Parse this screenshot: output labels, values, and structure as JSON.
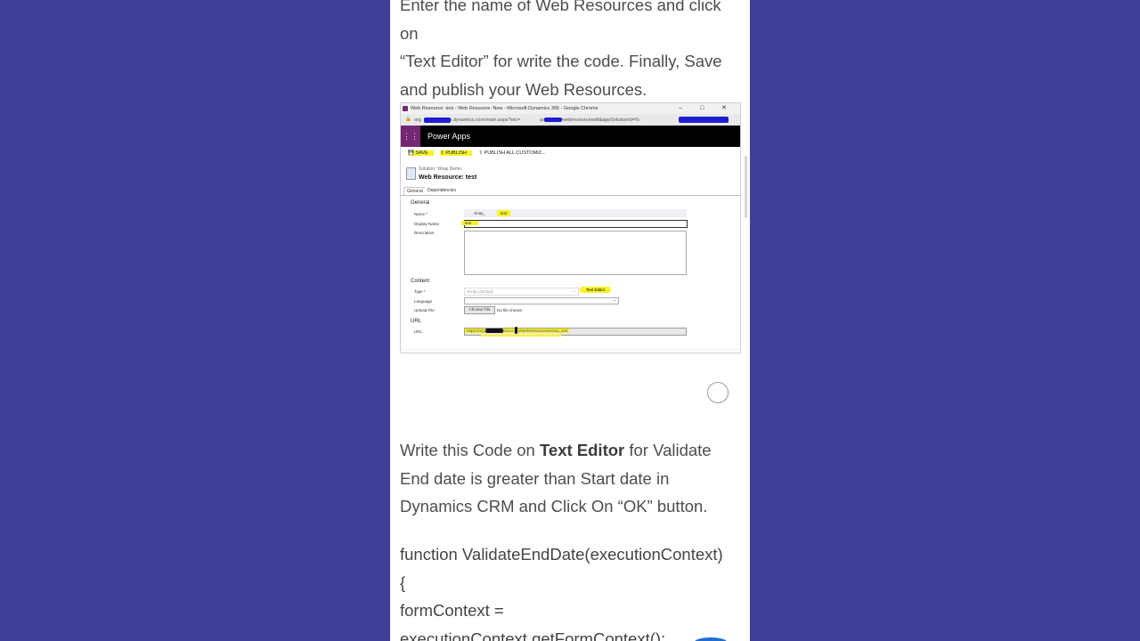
{
  "intro_text": {
    "line1": "Enter the name of Web Resources and click on",
    "line2": "“Text Editor” for write the code. Finally, Save",
    "line3": "and publish your Web Resources."
  },
  "screenshot": {
    "window_title": "Web Resource: test - Web Resource: New - Microsoft Dynamics 365 - Google Chrome",
    "window_controls": "–  □  ✕",
    "address_prefix": "org",
    "address_mid": "rm.dynamics.com/main.aspx?etc=",
    "address_tail": "pagetype=webresourceedit&appSolutionId=%",
    "app_name": "Power Apps",
    "commands": {
      "save": "SAVE",
      "publish": "PUBLISH",
      "publish_all": "PUBLISH ALL CUSTOMIZ..."
    },
    "solution_label": "Solution: Vinay Demo",
    "record_title": "Web Resource: test",
    "tabs": [
      "General",
      "Dependencies"
    ],
    "general_section": "General",
    "labels": {
      "name": "Name *",
      "display_name": "Display Name",
      "description": "Description",
      "type": "Type *",
      "language": "Language",
      "upload_file": "Upload File",
      "url": "URL"
    },
    "name_prefix": "vinay_",
    "name_value": "test",
    "display_name_value": "test",
    "content_section": "Content",
    "type_value": "Script (JScript)",
    "text_editor_button": "Text Editor",
    "choose_file_button": "Choose File",
    "no_file": "No file chosen",
    "url_section": "URL",
    "url_value": "https://org.crm.dynamics.com//WebResources/vinay_test"
  },
  "body_text": {
    "line1_pre": "Write this Code on ",
    "line1_bold": "Text Editor",
    "line1_post": " for Validate",
    "line2": "End date is greater than Start date in",
    "line3": "Dynamics CRM and Click On “OK” button."
  },
  "code": {
    "line1": "function ValidateEndDate(executionContext)",
    "line2": "{",
    "line3": "formContext =",
    "line4": "executionContext.getFormContext();"
  },
  "colors": {
    "page_background": "#3f3e96",
    "highlight": "#f8f22a",
    "power_apps_purple": "#742774"
  }
}
